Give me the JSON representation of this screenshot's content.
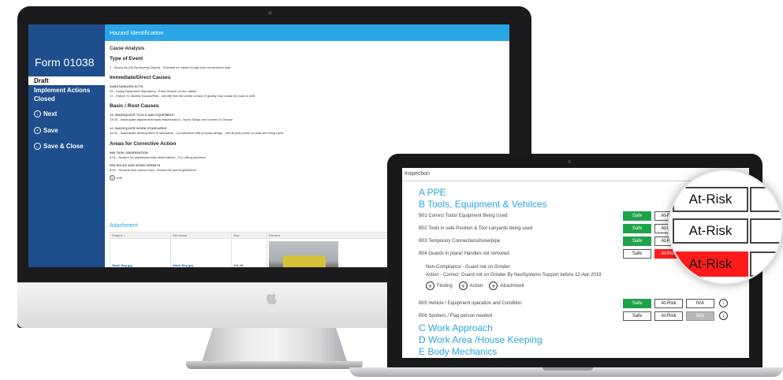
{
  "desktop_form": {
    "header_title": "Hazard Identification",
    "form_number": "Form 01038",
    "statuses": [
      "Draft",
      "Implement Actions",
      "Closed"
    ],
    "actions": [
      {
        "label": "Next",
        "icon": "arrow-down-circle-icon"
      },
      {
        "label": "Save",
        "icon": "save-circle-icon"
      },
      {
        "label": "Save & Close",
        "icon": "arrow-left-circle-icon"
      }
    ],
    "cause_analysis_heading": "Cause Analysis",
    "type_of_event_heading": "Type of Event",
    "type_of_event_item": "2 - Struck By (Hit By Moving Object) - Potential for cables to slip form un-centered load",
    "immediate_heading": "Immediate/Direct Causes",
    "substandard_acts": "SUBSTANDARD ACTS",
    "immediate_items": [
      "15 - Using Equipment Improperly - Extra tension on the cables",
      "17 - Failure To Identify Hazard/Risk - Identify that the centre of lack of gravity may cause the load to shift"
    ],
    "basic_heading": "Basic / Root Causes",
    "basic_sub_1": "13. INADEQUATE TOOLS AND EQUIPMENT",
    "basic_item_1": "13.05 - Inadequate adjustment/repair/maintenance - Nylon Slings are covered in Grease",
    "basic_sub_2": "14. INADEQUATE WORK STANDARDS",
    "basic_item_2": "14.02 - Inadequate development of standards - Coordination with process design - Not all pick points on load are being used",
    "corrective_heading": "Areas for Corrective Action",
    "corr_sub_1": "N06 TASK OBSERVATION",
    "corr_item_1": "6.01 - System for partial/spot task observations - For Lifting practices",
    "corr_sub_2": "N08 RULES AND WORK PERMITS",
    "corr_item_2": "8.01 - General loss control rules - Review lift permit guidelines",
    "edit_label": "Edit",
    "attachment_heading": "Attachment",
    "attachment_columns": [
      "Subject ↑",
      "File Name",
      "Size",
      "Preview"
    ],
    "attachment_row": {
      "subject": "Wash Bay.jpg",
      "file_name": "Wash Bay.jpg",
      "size": "406 kB"
    }
  },
  "inspection": {
    "window_title": "Inspection",
    "window_controls": "□ ✕",
    "sections": {
      "a": "A PPE",
      "b": "B Tools, Equipment & Vehilces",
      "c": "C Work Approach",
      "d": "D Work Area /House Keeping",
      "e": "E Body Mechanics"
    },
    "labels": {
      "safe": "Safe",
      "at_risk": "At-Risk",
      "na": "N/A"
    },
    "questions": [
      {
        "label": "B01 Correct Tools/ Equipment Being Used",
        "selected": "safe"
      },
      {
        "label": "B02 Tools in safe Position & Tool Lanyards being used",
        "selected": "safe"
      },
      {
        "label": "B03 Temporary Connections/hose/pipe",
        "selected": "safe"
      },
      {
        "label": "B04 Guards in place/ Handles not removed",
        "selected": "at_risk"
      },
      {
        "label": "B05 Vehicle / Equipment operation and Condition",
        "selected": "safe"
      },
      {
        "label": "B06 Spotters / Flag person needed",
        "selected": "na"
      }
    ],
    "finding_text": "Non-Compliance - Guard not on Grinder",
    "action_text": "Action - Correct: Guard not on Grinder By NeoSystems Support before 12-Apr-2018",
    "add_buttons": [
      "Finding",
      "Action",
      "Attachment"
    ]
  },
  "magnifier": {
    "labels": [
      "At-Risk",
      "At-Risk",
      "At-Risk"
    ]
  },
  "colors": {
    "header_blue": "#2aa5e6",
    "sidebar_navy": "#1f4e8c",
    "safe_green": "#1fa34a",
    "risk_red": "#ff1b1b"
  }
}
